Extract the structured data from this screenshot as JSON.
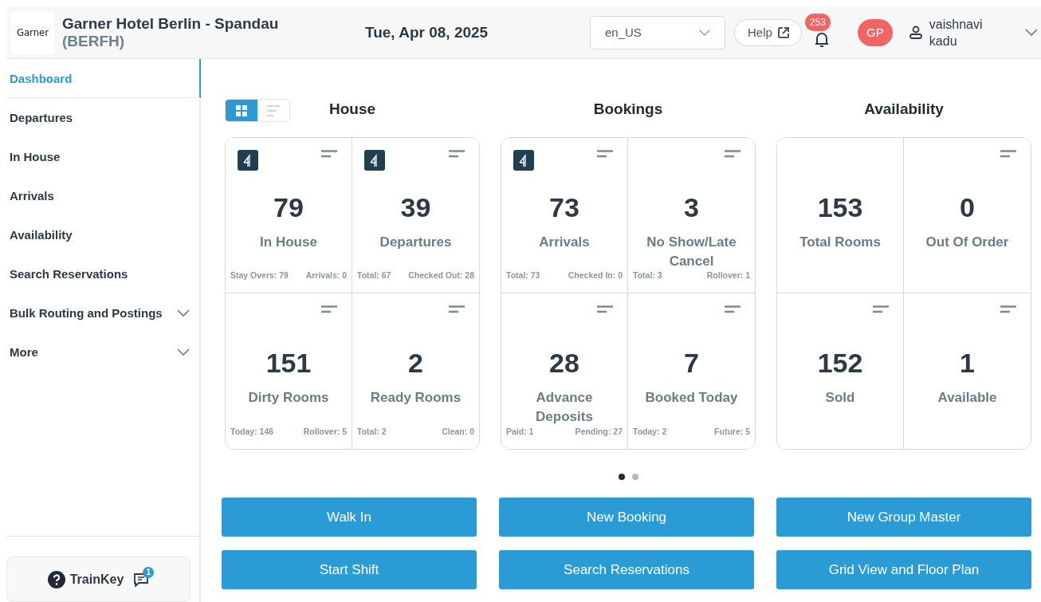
{
  "header": {
    "logo": "Garner",
    "hotel_name": "Garner Hotel Berlin - Spandau",
    "hotel_code": "(BERFH)",
    "date": "Tue, Apr 08, 2025",
    "locale": "en_US",
    "help": "Help",
    "notifications": "253",
    "avatar": "GP",
    "user": "vaishnavi kadu"
  },
  "sidebar": {
    "items": [
      {
        "label": "Dashboard",
        "selected": true,
        "kind": "link"
      },
      {
        "label": "Departures",
        "selected": false,
        "kind": "link"
      },
      {
        "label": "In House",
        "selected": false,
        "kind": "link"
      },
      {
        "label": "Arrivals",
        "selected": false,
        "kind": "link"
      },
      {
        "label": "Availability",
        "selected": false,
        "kind": "link"
      },
      {
        "label": "Search Reservations",
        "selected": false,
        "kind": "link"
      },
      {
        "label": "Bulk Routing and Postings",
        "selected": false,
        "kind": "group",
        "expanded": false
      },
      {
        "label": "More",
        "selected": false,
        "kind": "group",
        "expanded": false
      }
    ],
    "trainkey": {
      "label": "TrainKey",
      "count": "1"
    }
  },
  "view_toggle": [
    {
      "kind": "grid",
      "selected": true
    },
    {
      "kind": "list",
      "selected": false
    }
  ],
  "groups": [
    {
      "title": "House",
      "tiles": [
        {
          "logo": true,
          "menu": true,
          "value": "79",
          "label": "In House",
          "details": [
            "Stay Overs: 79",
            "Arrivals: 0"
          ]
        },
        {
          "logo": true,
          "menu": true,
          "value": "39",
          "label": "Departures",
          "details": [
            "Total: 67",
            "Checked Out: 28"
          ]
        },
        {
          "logo": false,
          "menu": true,
          "value": "151",
          "label": "Dirty Rooms",
          "details": [
            "Today: 146",
            "Rollover: 5"
          ]
        },
        {
          "logo": false,
          "menu": true,
          "value": "2",
          "label": "Ready Rooms",
          "details": [
            "Total: 2",
            "Clean: 0"
          ]
        }
      ]
    },
    {
      "title": "Bookings",
      "tiles": [
        {
          "logo": true,
          "menu": true,
          "value": "73",
          "label": "Arrivals",
          "details": [
            "Total: 73",
            "Checked In: 0"
          ]
        },
        {
          "logo": false,
          "menu": true,
          "value": "3",
          "label": "No Show/Late Cancel",
          "details": [
            "Total: 3",
            "Rollover: 1"
          ]
        },
        {
          "logo": false,
          "menu": true,
          "value": "28",
          "label": "Advance Deposits",
          "details": [
            "Paid: 1",
            "Pending: 27"
          ]
        },
        {
          "logo": false,
          "menu": true,
          "value": "7",
          "label": "Booked Today",
          "details": [
            "Today: 2",
            "Future: 5"
          ]
        }
      ]
    },
    {
      "title": "Availability",
      "tiles": [
        {
          "logo": false,
          "menu": false,
          "value": "153",
          "label": "Total Rooms"
        },
        {
          "logo": false,
          "menu": true,
          "value": "0",
          "label": "Out Of Order"
        },
        {
          "logo": false,
          "menu": true,
          "value": "152",
          "label": "Sold"
        },
        {
          "logo": false,
          "menu": true,
          "value": "1",
          "label": "Available"
        }
      ]
    }
  ],
  "pager": [
    {
      "selected": true
    },
    {
      "selected": false
    }
  ],
  "actions": [
    "Walk In",
    "New Booking",
    "New Group Master",
    "Start Shift",
    "Search Reservations",
    "Grid View and Floor Plan"
  ]
}
